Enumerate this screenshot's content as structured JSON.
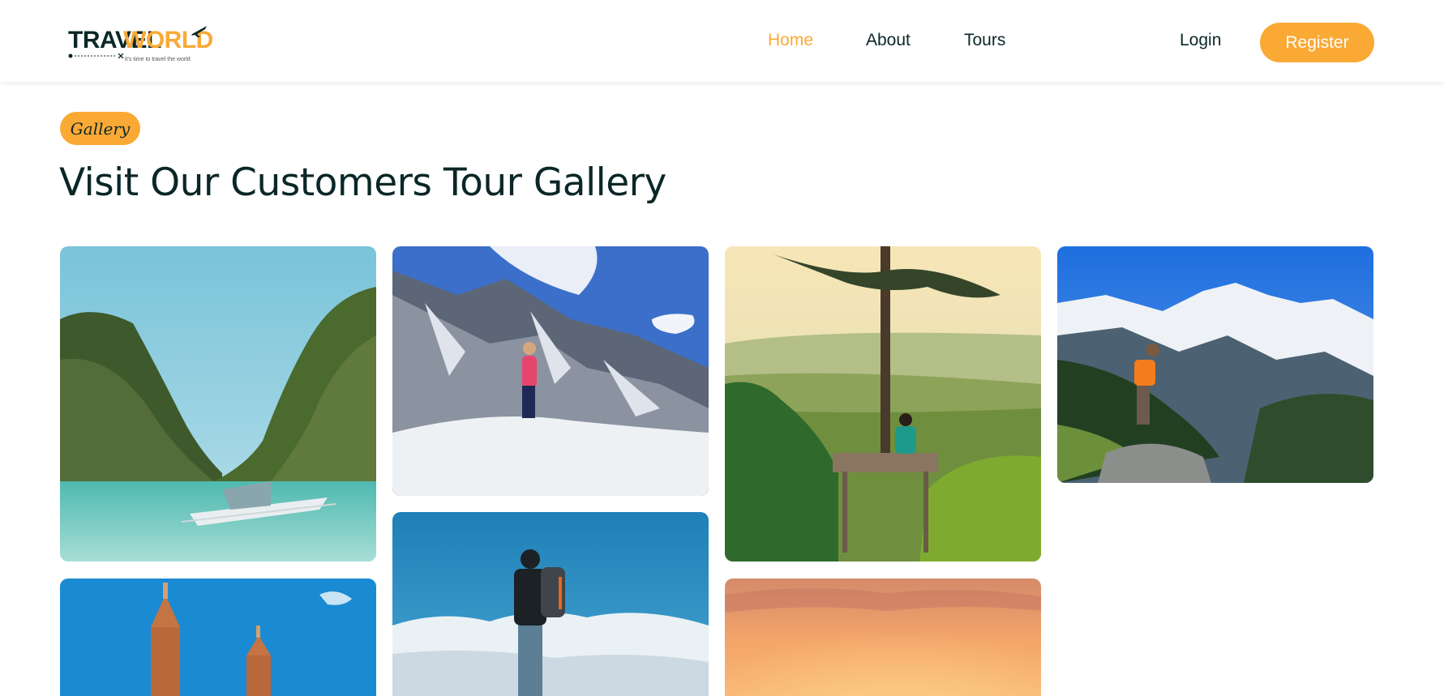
{
  "header": {
    "logo": {
      "word1": "TRAVEL",
      "word2": "WORLD",
      "tagline": "it's time to travel the world"
    },
    "nav": [
      {
        "label": "Home",
        "active": true
      },
      {
        "label": "About",
        "active": false
      },
      {
        "label": "Tours",
        "active": false
      }
    ],
    "login_label": "Login",
    "register_label": "Register"
  },
  "section": {
    "badge": "Gallery",
    "title": "Visit Our Customers Tour Gallery"
  },
  "colors": {
    "accent": "#faa935",
    "heading": "#0b2727"
  },
  "gallery": {
    "images": [
      {
        "name": "lagoon-boat-photo",
        "subject": "lagoon with boat between cliffs"
      },
      {
        "name": "snow-mountaineer-photo",
        "subject": "climber on snowy mountain"
      },
      {
        "name": "treehouse-valley-photo",
        "subject": "person sitting on tree platform over valley"
      },
      {
        "name": "hiker-peak-photo",
        "subject": "hiker with orange backpack facing snowy peaks"
      },
      {
        "name": "church-towers-photo",
        "subject": "church towers under blue sky"
      },
      {
        "name": "backpacker-clouds-photo",
        "subject": "backpacker looking at clouds"
      },
      {
        "name": "sunset-sky-photo",
        "subject": "orange sunset sky"
      }
    ]
  }
}
